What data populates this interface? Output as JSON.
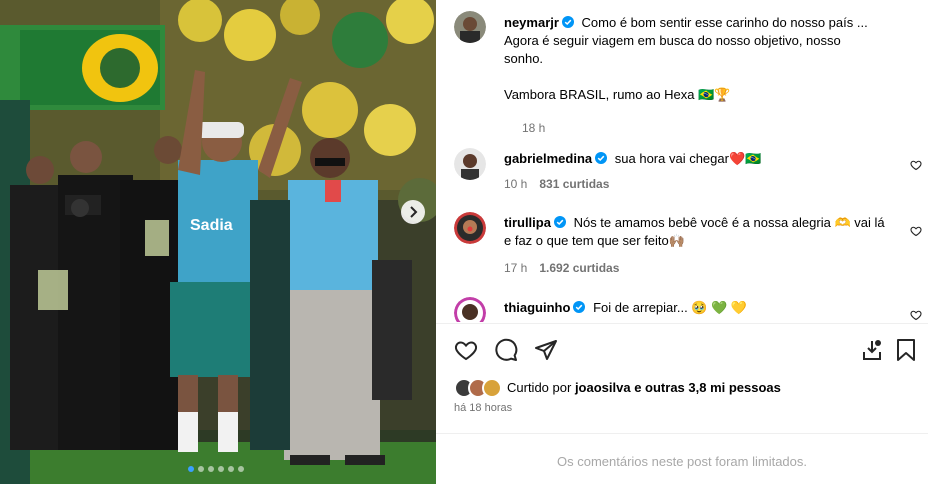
{
  "post": {
    "author": "neymarjr",
    "caption_line1": "Como é bom sentir esse carinho do nosso país ...",
    "caption_line2": "Agora é seguir viagem em busca do nosso objetivo, nosso",
    "caption_line3": "sonho.",
    "caption_line4": "Vambora BRASIL, rumo ao Hexa 🇧🇷🏆",
    "time": "18 h"
  },
  "comments": [
    {
      "user": "gabrielmedina",
      "text": "sua hora vai chegar❤️🇧🇷",
      "time": "10 h",
      "likes": "831 curtidas"
    },
    {
      "user": "tirullipa",
      "text": "Nós te amamos bebê você é a nossa alegria 🫶 vai lá e faz o que tem que ser feito🙌🏽",
      "time": "17 h",
      "likes": "1.692 curtidas"
    },
    {
      "user": "thiaguinho",
      "text": "Foi de arrepiar... 🥹 💚 💛"
    }
  ],
  "likes": {
    "prefix": "Curtido por",
    "user": "joaosilva",
    "suffix": "e outras 3,8 mi pessoas"
  },
  "post_date": "há 18 horas",
  "comments_limited": "Os comentários neste post foram limitados.",
  "carousel": {
    "count": 6,
    "active_index": 0
  },
  "colors": {
    "verified": "#0095f6",
    "muted": "#737373",
    "divider": "#efefef",
    "jersey": "#3fa3c8",
    "dot_active": "#3aa0ff"
  },
  "icons": [
    "heart-icon",
    "comment-icon",
    "share-icon",
    "save-icon",
    "bookmark-icon",
    "chevron-right-icon",
    "verified-icon"
  ]
}
